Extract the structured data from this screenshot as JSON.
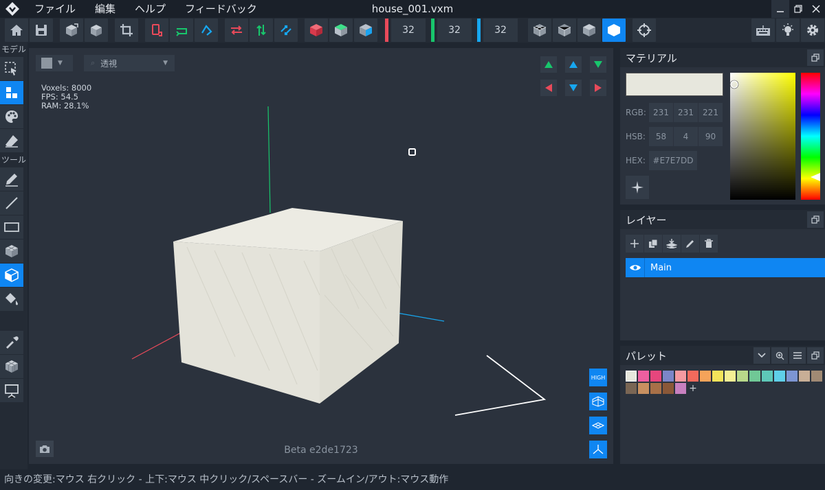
{
  "menubar": {
    "items": [
      "ファイル",
      "編集",
      "ヘルプ",
      "フィードバック"
    ],
    "title": "house_001.vxm"
  },
  "toolbar": {
    "dims": [
      {
        "value": "32",
        "color": "#e84a5a"
      },
      {
        "value": "32",
        "color": "#18c66c"
      },
      {
        "value": "32",
        "color": "#17a7f0"
      }
    ]
  },
  "left_toolbar": {
    "section_model": "モデル",
    "section_tools": "ツール"
  },
  "viewport": {
    "view_mode": "透視",
    "stats": {
      "voxels": "Voxels: 8000",
      "fps": "FPS: 54.5",
      "ram": "RAM: 28.1%"
    },
    "quality_badge": "HIGH",
    "version": "Beta e2de1723"
  },
  "material": {
    "title": "マテリアル",
    "current_color": "#e7e7dd",
    "rgb_label": "RGB:",
    "rgb": [
      "231",
      "231",
      "221"
    ],
    "hsb_label": "HSB:",
    "hsb": [
      "58",
      "4",
      "90"
    ],
    "hex_label": "HEX:",
    "hex": "#E7E7DD"
  },
  "layers": {
    "title": "レイヤー",
    "items": [
      {
        "name": "Main",
        "visible": true,
        "selected": true
      }
    ]
  },
  "palette": {
    "title": "パレット",
    "colors": [
      "#e7e7dd",
      "#ee5fa0",
      "#e7467d",
      "#7c86c8",
      "#f59aa0",
      "#f36a5c",
      "#f5a35a",
      "#f4e45a",
      "#f5ef94",
      "#b8d98a",
      "#70c896",
      "#5ec8b8",
      "#5fcfe8",
      "#7d95d2",
      "#c8ae96",
      "#a08a74",
      "#7a6654",
      "#c89060",
      "#a87048",
      "#8a5838",
      "#c880c0"
    ]
  },
  "statusbar": {
    "text": "向きの変更:マウス 右クリック - 上下:マウス 中クリック/スペースバー - ズームイン/アウト:マウス動作"
  }
}
